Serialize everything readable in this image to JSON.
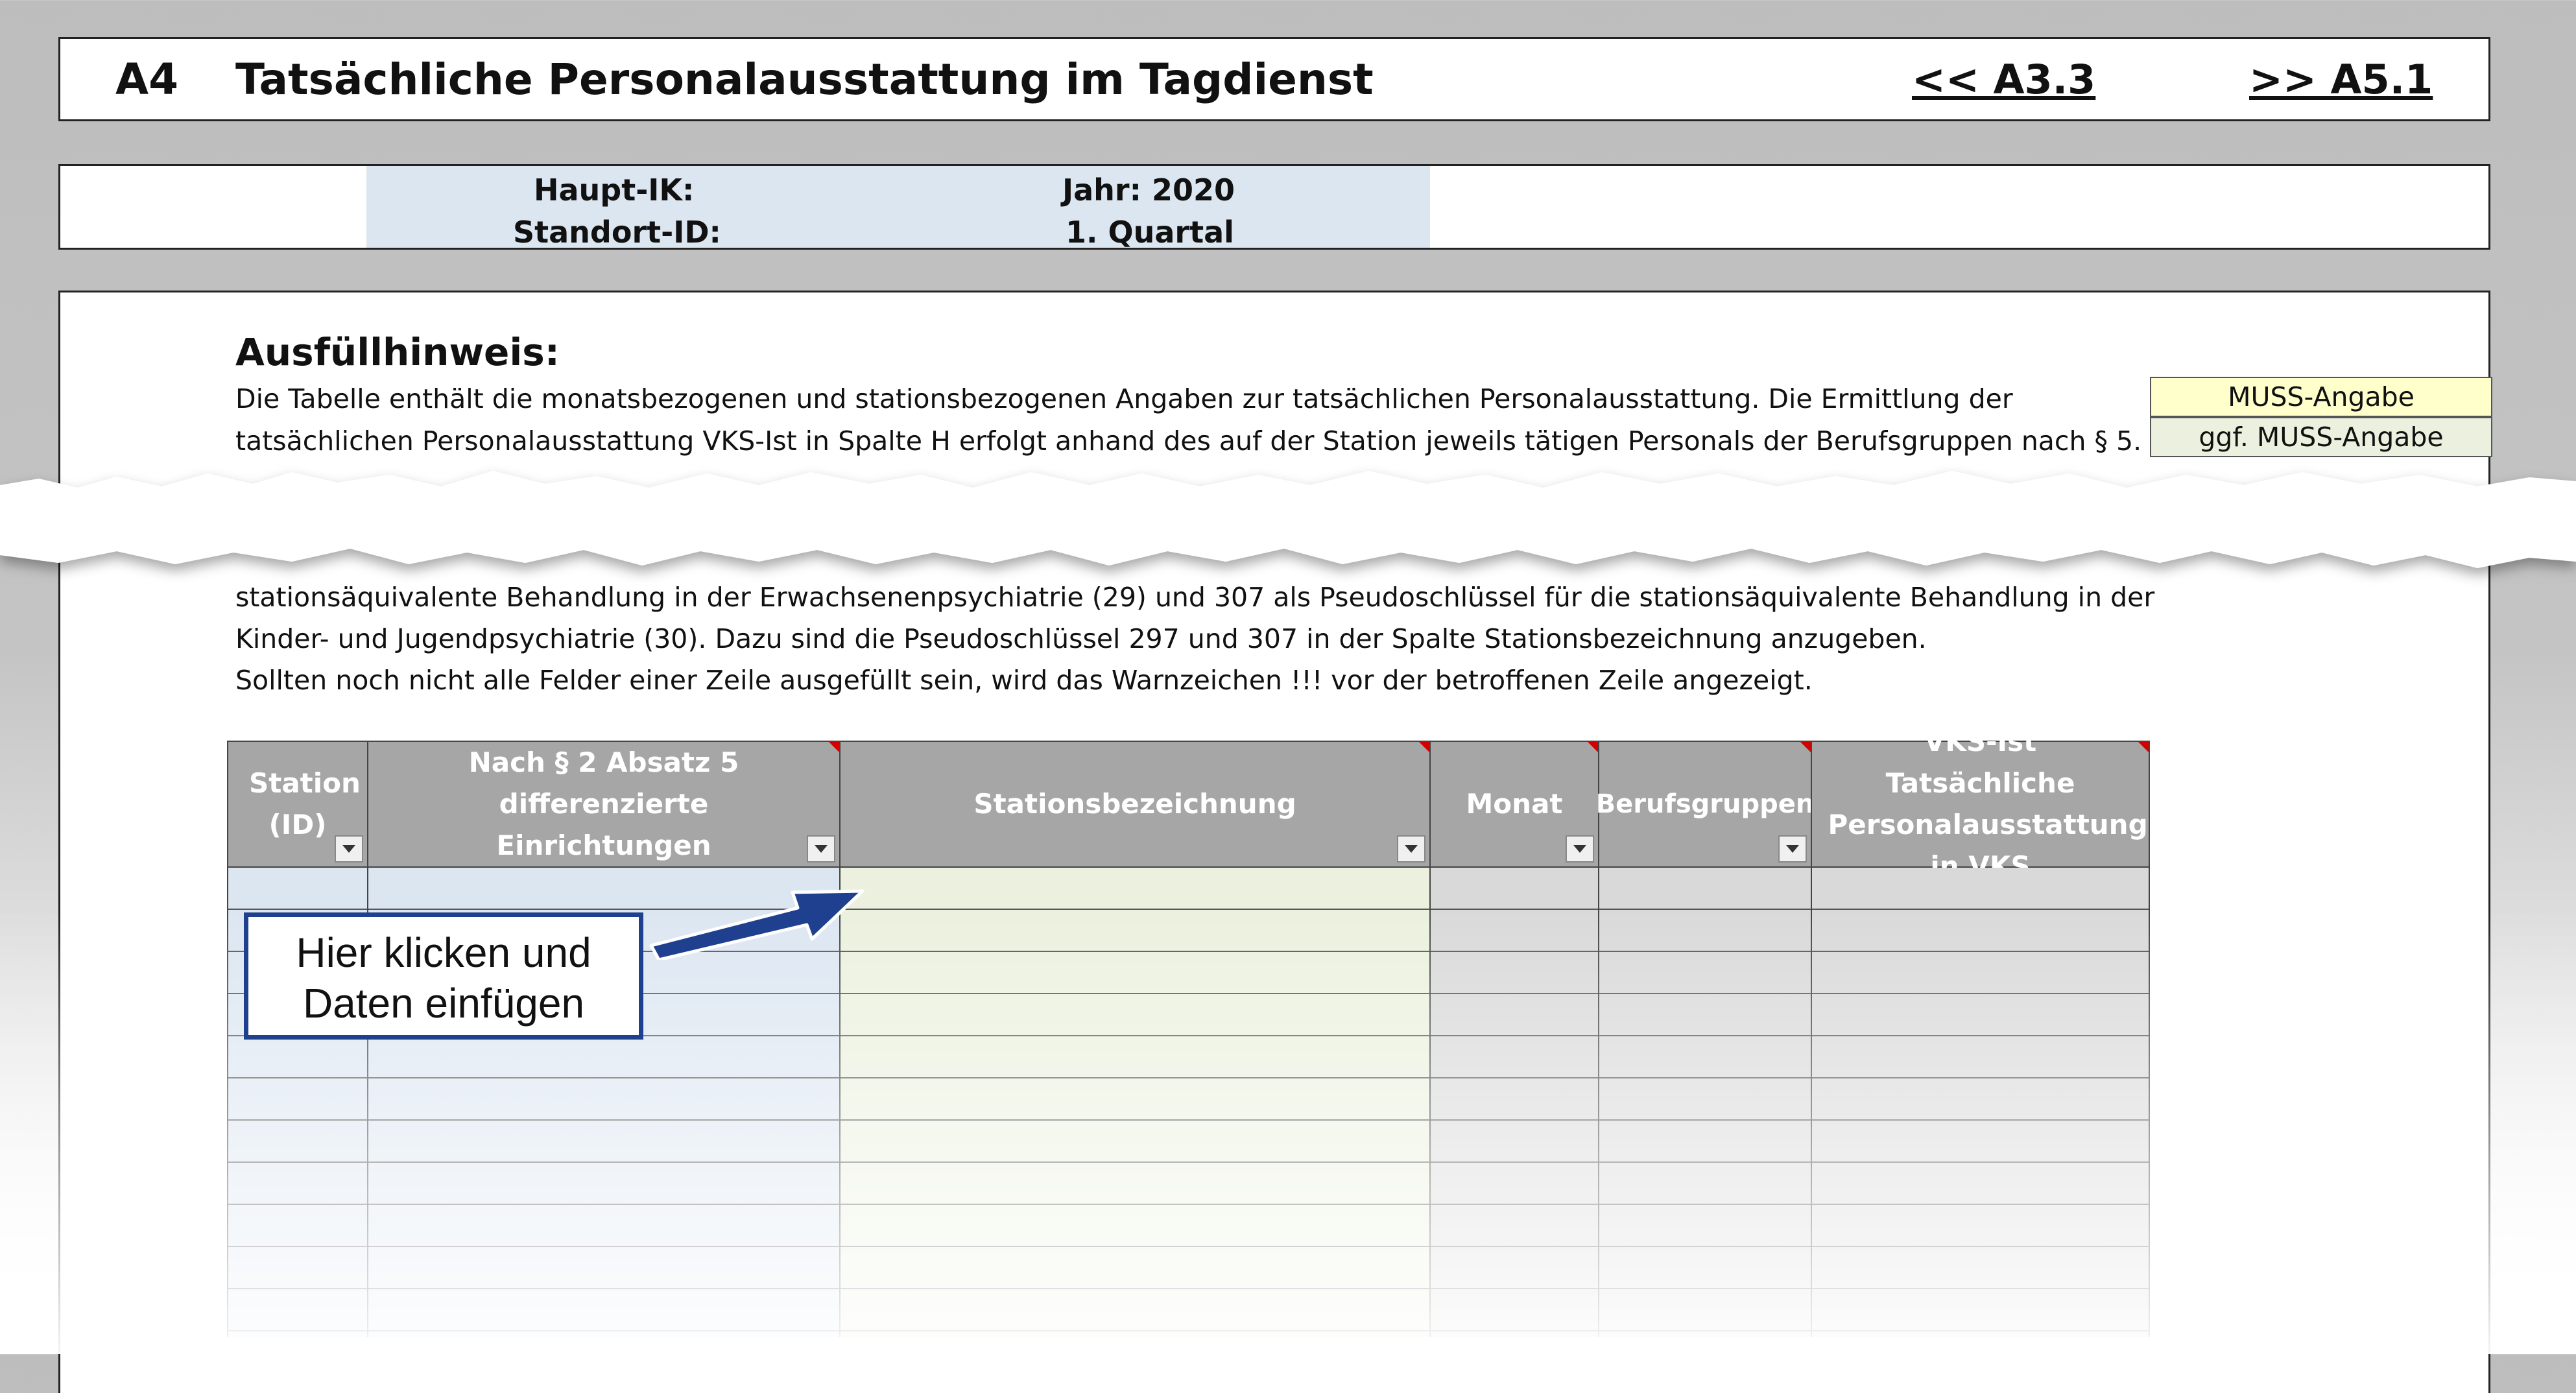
{
  "header": {
    "code": "A4",
    "title": "Tatsächliche Personalausstattung im Tagdienst",
    "link_prev": "<< A3.3",
    "link_next": ">> A5.1"
  },
  "id_bar": {
    "haupt_ik": "Haupt-IK:",
    "standort_id": "Standort-ID:",
    "jahr": "Jahr: 2020",
    "quartal": "1. Quartal"
  },
  "hint": {
    "title": "Ausfüllhinweis:",
    "lines": [
      "Die Tabelle enthält die monatsbezogenen und stationsbezogenen Angaben zur tatsächlichen Personalausstattung. Die Ermittlung der",
      "tatsächlichen Personalausstattung VKS-Ist in Spalte H erfolgt anhand des auf der Station jeweils tätigen Personals der Berufsgruppen nach § 5.",
      "stationsäquivalente Behandlung in der Erwachsenenpsychiatrie (29) und 307 als Pseudoschlüssel für die stationsäquivalente Behandlung in der",
      "Kinder- und Jugendpsychiatrie (30). Dazu sind die Pseudoschlüssel 297 und 307 in der Spalte Stationsbezeichnung anzugeben.",
      "Sollten noch nicht alle Felder einer Zeile ausgefüllt sein, wird das Warnzeichen !!!  vor der betroffenen Zeile angezeigt."
    ]
  },
  "legend": {
    "muss": "MUSS-Angabe",
    "ggf": "ggf. MUSS-Angabe"
  },
  "table": {
    "headers": [
      "Station (ID)",
      "Nach § 2 Absatz 5 differenzierte Einrichtungen",
      "Stationsbezeichnung",
      "Monat",
      "Berufsgruppen",
      "VKS-Ist Tatsächliche Personalausstattung in VKS"
    ]
  },
  "callout": {
    "line1": "Hier klicken und",
    "line2": "Daten einfügen"
  },
  "colors": {
    "header_grey": "#a6a6a6",
    "input_blue": "#dce6f1",
    "input_green": "#ebf1de",
    "readonly_grey": "#d9d9d9",
    "muss_yellow": "#ffffcc",
    "callout_border": "#1f3f8f"
  }
}
